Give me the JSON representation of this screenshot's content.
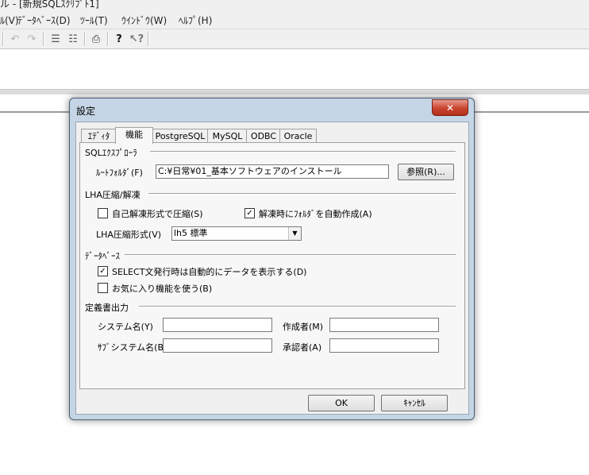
{
  "app": {
    "title_fragment": "ル - [新規SQLｽｸﾘﾌﾟﾄ1]",
    "menu": [
      "ﾙ(V)",
      "ﾃﾞｰﾀﾍﾞｰｽ(D)",
      "ﾂｰﾙ(T)",
      "ｳｲﾝﾄﾞｳ(W)",
      "ﾍﾙﾌﾟ(H)"
    ],
    "toolbar_icons": [
      "undo-icon",
      "redo-icon",
      "align-left-icon",
      "align-right-icon",
      "printer-icon",
      "help-icon",
      "context-help-icon"
    ]
  },
  "dialog": {
    "title": "設定",
    "close_glyph": "✕",
    "tabs": [
      "ｴﾃﾞｨﾀ",
      "機能",
      "PostgreSQL",
      "MySQL",
      "ODBC",
      "Oracle"
    ],
    "active_tab": "機能",
    "sql_explorer": {
      "header": "SQLｴｸｽﾌﾟﾛｰﾗ",
      "root_folder_label": "ﾙｰﾄﾌｫﾙﾀﾞ(F)",
      "root_folder_value": "C:¥日常¥01_基本ソフトウェアのインストール",
      "browse_button": "参照(R)..."
    },
    "lha": {
      "header": "LHA圧縮/解凍",
      "self_extract_label": "自己解凍形式で圧縮(S)",
      "self_extract_checked": false,
      "auto_folder_label": "解凍時にﾌｫﾙﾀﾞを自動作成(A)",
      "auto_folder_checked": true,
      "format_label": "LHA圧縮形式(V)",
      "format_value": "lh5 標準"
    },
    "database": {
      "header": "ﾃﾞｰﾀﾍﾞｰｽ",
      "auto_show_label": "SELECT文発行時は自動的にデータを表示する(D)",
      "auto_show_checked": true,
      "favorites_label": "お気に入り機能を使う(B)",
      "favorites_checked": false
    },
    "spec_output": {
      "header": "定義書出力",
      "system_label": "システム名(Y)",
      "system_value": "",
      "author_label": "作成者(M)",
      "author_value": "",
      "subsystem_label": "ｻﾌﾞシステム名(B)",
      "subsystem_value": "",
      "approver_label": "承認者(A)",
      "approver_value": ""
    },
    "ok_button": "OK",
    "cancel_button": "ｷｬﾝｾﾙ",
    "check_glyph": "✓"
  }
}
